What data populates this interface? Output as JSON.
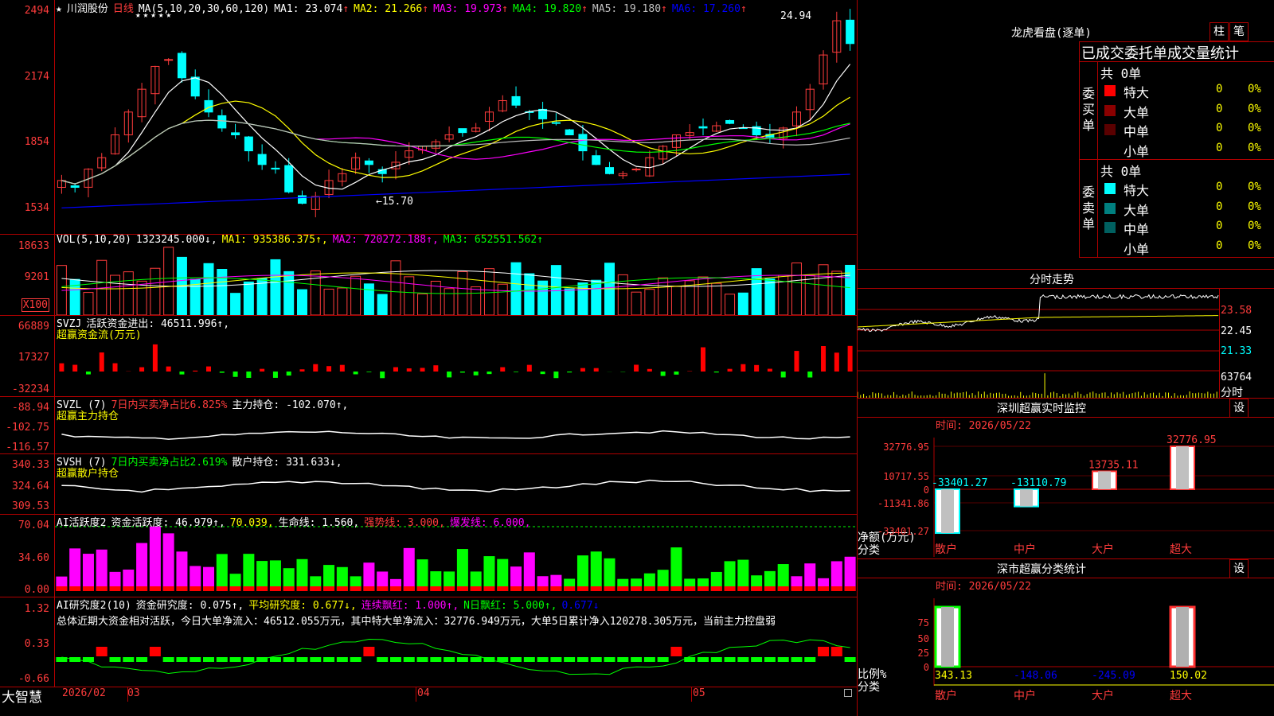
{
  "stock": {
    "name": "川润股份",
    "period": "日线",
    "ma_header": "MA(5,10,20,30,60,120)",
    "ma": [
      {
        "label": "MA1: 23.074",
        "arrow": "↑",
        "color": "#ffffff"
      },
      {
        "label": "MA2: 21.266",
        "arrow": "↑",
        "color": "#ffff00"
      },
      {
        "label": "MA3: 19.973",
        "arrow": "↑",
        "color": "#ff00ff"
      },
      {
        "label": "MA4: 19.820",
        "arrow": "↑",
        "color": "#00ff00"
      },
      {
        "label": "MA5: 19.180",
        "arrow": "↑",
        "color": "#c0c0c0"
      },
      {
        "label": "MA6: 17.260",
        "arrow": "↑",
        "color": "#0000ff"
      }
    ],
    "star": "★",
    "high_label": "24.94",
    "low_label": "←15.70",
    "price_axis": [
      "2494",
      "2174",
      "1854",
      "1534"
    ]
  },
  "volume": {
    "header": "VOL(5,10,20)",
    "value": "1323245.000↓,",
    "ma1": "MA1: 935386.375↑,",
    "ma2": "MA2: 720272.188↑,",
    "ma3": "MA3: 652551.562↑",
    "axis": [
      "18633",
      "9201"
    ],
    "unit": "X100"
  },
  "svzj": {
    "header": "SVZJ",
    "desc": "活跃资金进出: 46511.996↑,",
    "name": "超赢资金流(万元)",
    "axis": [
      "66889",
      "17327",
      "-32234"
    ]
  },
  "svzl": {
    "header": "SVZL (7)",
    "desc1": "7日内买卖净占比6.825%",
    "desc2": "主力持仓: -102.070↑,",
    "name": "超赢主力持仓",
    "axis": [
      "-88.94",
      "-102.75",
      "-116.57"
    ]
  },
  "svsh": {
    "header": "SVSH (7)",
    "desc1": "7日内买卖净占比2.619%",
    "desc2": "散户持仓: 331.633↓,",
    "name": "超赢散户持仓",
    "axis": [
      "340.33",
      "324.64",
      "309.53"
    ]
  },
  "ai1": {
    "header": "AI活跃度2",
    "v1": "资金活跃度: 46.979↑,",
    "v2": "70.039,",
    "v3": "生命线: 1.560,",
    "v4": "强势线: 3.000,",
    "v5": "爆发线: 6.000,",
    "axis": [
      "70.04",
      "34.60",
      "0.00"
    ]
  },
  "ai2": {
    "header": "AI研究度2(10)",
    "v1": "资金研究度: 0.075↑,",
    "v2": "平均研究度: 0.677↓,",
    "v3": "连续飘红: 1.000↑,",
    "v4": "N日飘红: 5.000↑,",
    "v5": "0.677↓",
    "summary": "总体近期大资金相对活跃，今日大单净流入：46512.055万元，其中特大单净流入：32776.949万元，大单5日累计净入120278.305万元，当前主力控盘弱",
    "axis": [
      "1.32",
      "0.33",
      "-0.66"
    ]
  },
  "bottom": {
    "brand": "大智慧",
    "dates": [
      "2026/02",
      "03",
      "04",
      "05"
    ]
  },
  "right": {
    "lhb_title": "龙虎看盘(逐单)",
    "btn1": "柱",
    "btn2": "笔",
    "stats_title": "已成交委托单成交量统计",
    "buy": {
      "side": [
        "委",
        "买",
        "单"
      ],
      "total": "共 0单",
      "rows": [
        {
          "label": "特大",
          "num": "0",
          "pct": "0%",
          "color": "#ff0000"
        },
        {
          "label": "大单",
          "num": "0",
          "pct": "0%",
          "color": "#8b0000"
        },
        {
          "label": "中单",
          "num": "0",
          "pct": "0%",
          "color": "#5a0000"
        },
        {
          "label": "小单",
          "num": "0",
          "pct": "0%",
          "color": "#000000"
        }
      ]
    },
    "sell": {
      "side": [
        "委",
        "卖",
        "单"
      ],
      "total": "共 0单",
      "rows": [
        {
          "label": "特大",
          "num": "0",
          "pct": "0%",
          "color": "#00ffff"
        },
        {
          "label": "大单",
          "num": "0",
          "pct": "0%",
          "color": "#008080"
        },
        {
          "label": "中单",
          "num": "0",
          "pct": "0%",
          "color": "#006060"
        },
        {
          "label": "小单",
          "num": "0",
          "pct": "0%",
          "color": "#000000"
        }
      ]
    },
    "intraday_title": "分时走势",
    "intraday_axis": [
      "23.58",
      "22.45",
      "21.33",
      "63764",
      "分时"
    ],
    "monitor_title": "深圳超赢实时监控",
    "settings": "设",
    "monitor_time": "时间: 2026/05/22",
    "monitor_axis": [
      "32776.95",
      "10717.55",
      "0",
      "-11341.86",
      "-33401.27"
    ],
    "monitor_left_labels": [
      "净额(万元)",
      "分类"
    ],
    "monitor_values": [
      {
        "cat": "散户",
        "value": -33401.27,
        "text": "-33401.27"
      },
      {
        "cat": "中户",
        "value": -13110.79,
        "text": "-13110.79"
      },
      {
        "cat": "大户",
        "value": 13735.11,
        "text": "13735.11"
      },
      {
        "cat": "超大",
        "value": 32776.95,
        "text": "32776.95"
      }
    ],
    "class_title": "深市超赢分类统计",
    "class_time": "时间: 2026/05/22",
    "class_axis": [
      "75",
      "50",
      "25",
      "0"
    ],
    "class_left_labels": [
      "比例%",
      "分类"
    ],
    "class_values": [
      {
        "cat": "散户",
        "value": 343.13,
        "text": "343.13"
      },
      {
        "cat": "中户",
        "value": -148.06,
        "text": "-148.06"
      },
      {
        "cat": "大户",
        "value": -245.09,
        "text": "-245.09"
      },
      {
        "cat": "超大",
        "value": 150.02,
        "text": "150.02"
      }
    ]
  }
}
